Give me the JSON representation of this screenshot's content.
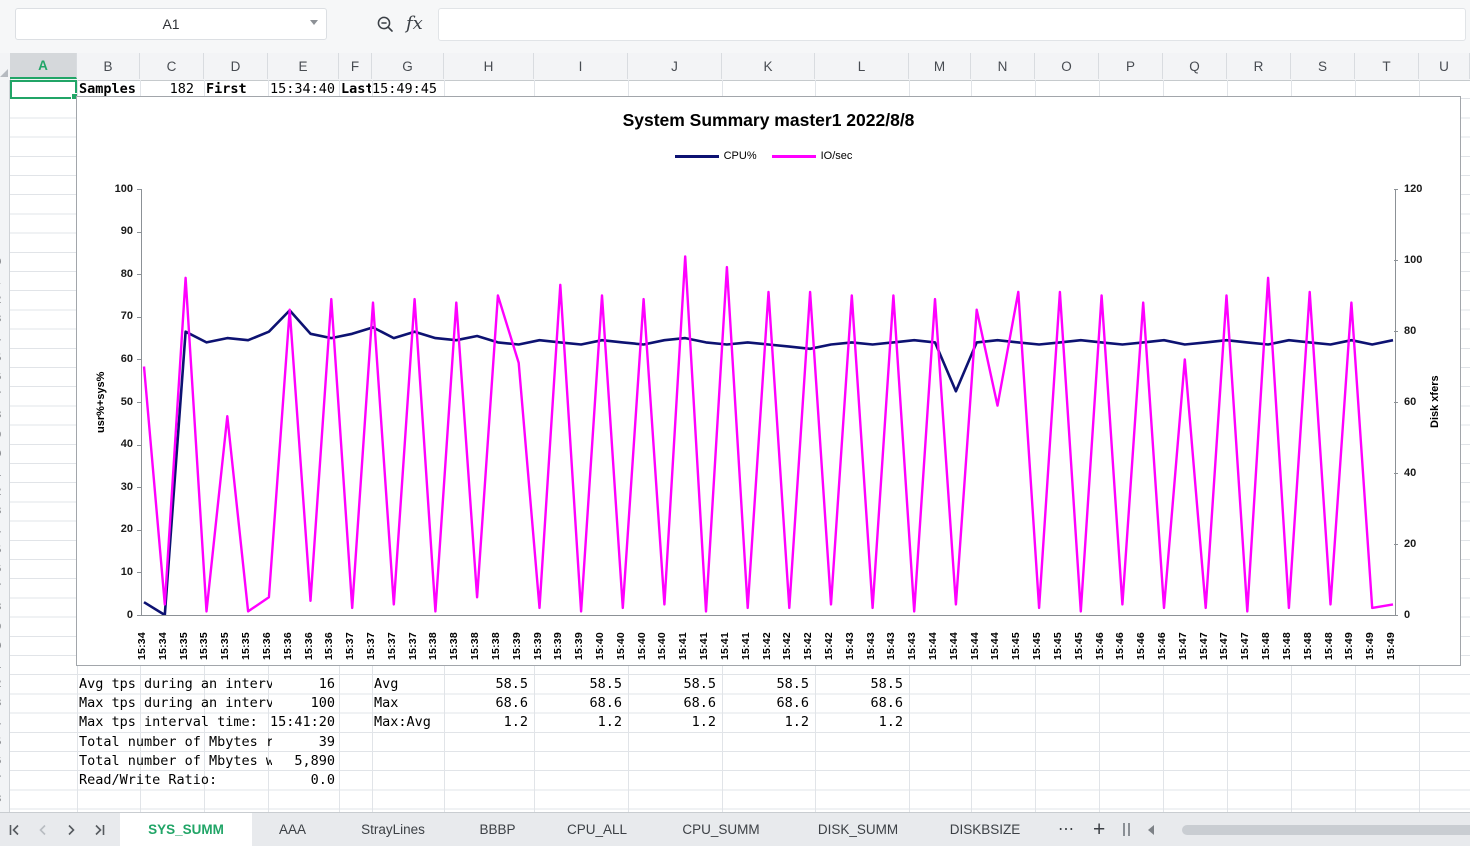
{
  "toolbar": {
    "name_box": "A1",
    "fx_label": "fx",
    "formula_value": ""
  },
  "columns": [
    "A",
    "B",
    "C",
    "D",
    "E",
    "F",
    "G",
    "H",
    "I",
    "J",
    "K",
    "L",
    "M",
    "N",
    "O",
    "P",
    "Q",
    "R",
    "S",
    "T",
    "U"
  ],
  "sheet": {
    "row1": {
      "b": "Samples",
      "c": "182",
      "d": "First",
      "e": "15:34:40",
      "f": "Last",
      "g": "15:49:45"
    },
    "stats": [
      {
        "label": "Avg tps during an interv",
        "value": "16"
      },
      {
        "label": "Max tps during an interv",
        "value": "100"
      },
      {
        "label": "Max tps interval time:",
        "value": "15:41:20"
      },
      {
        "label": "Total number of Mbytes r",
        "value": "39"
      },
      {
        "label": "Total number of Mbytes w",
        "value": "5,890"
      },
      {
        "label": "Read/Write Ratio:",
        "value": "0.0"
      }
    ],
    "summary_rows": [
      {
        "label": "Avg",
        "values": [
          "58.5",
          "58.5",
          "58.5",
          "58.5",
          "58.5"
        ]
      },
      {
        "label": "Max",
        "values": [
          "68.6",
          "68.6",
          "68.6",
          "68.6",
          "68.6"
        ]
      },
      {
        "label": "Max:Avg",
        "values": [
          "1.2",
          "1.2",
          "1.2",
          "1.2",
          "1.2"
        ]
      }
    ]
  },
  "chart_data": {
    "type": "line",
    "title": "System Summary master1  2022/8/8",
    "legend_position": "top",
    "ylabel_left": "usr%+sys%",
    "ylabel_right": "Disk xfers",
    "ylim_left": [
      0,
      100
    ],
    "ylim_right": [
      0,
      120
    ],
    "yticks_left": [
      100,
      90,
      80,
      70,
      60,
      50,
      40,
      30,
      20,
      10,
      0
    ],
    "yticks_right": [
      120,
      100,
      80,
      60,
      40,
      20,
      0
    ],
    "grid": false,
    "x": [
      "15:34",
      "15:34",
      "15:35",
      "15:35",
      "15:35",
      "15:35",
      "15:36",
      "15:36",
      "15:36",
      "15:36",
      "15:37",
      "15:37",
      "15:37",
      "15:37",
      "15:38",
      "15:38",
      "15:38",
      "15:38",
      "15:39",
      "15:39",
      "15:39",
      "15:39",
      "15:40",
      "15:40",
      "15:40",
      "15:40",
      "15:41",
      "15:41",
      "15:41",
      "15:41",
      "15:42",
      "15:42",
      "15:42",
      "15:42",
      "15:43",
      "15:43",
      "15:43",
      "15:43",
      "15:44",
      "15:44",
      "15:44",
      "15:44",
      "15:45",
      "15:45",
      "15:45",
      "15:45",
      "15:46",
      "15:46",
      "15:46",
      "15:46",
      "15:47",
      "15:47",
      "15:47",
      "15:47",
      "15:48",
      "15:48",
      "15:48",
      "15:48",
      "15:49",
      "15:49",
      "15:49"
    ],
    "series": [
      {
        "name": "CPU%",
        "axis": "left",
        "color": "#0d1272",
        "values": [
          3,
          0,
          66.5,
          64,
          65,
          64.5,
          66.5,
          71.5,
          66,
          65,
          66,
          67.5,
          65,
          66.5,
          65,
          64.5,
          65.5,
          64,
          63.5,
          64.5,
          64,
          63.5,
          64.5,
          64,
          63.5,
          64.5,
          65,
          64,
          63.5,
          64,
          63.5,
          63,
          62.5,
          63.5,
          64,
          63.5,
          64,
          64.5,
          64,
          52.5,
          64,
          64.5,
          64,
          63.5,
          64,
          64.5,
          64,
          63.5,
          64,
          64.5,
          63.5,
          64,
          64.5,
          64,
          63.5,
          64.5,
          64,
          63.5,
          64.5,
          63.5,
          64.5
        ]
      },
      {
        "name": "IO/sec",
        "axis": "right",
        "color": "#ff00ff",
        "values": [
          70,
          3,
          95,
          1,
          56,
          1,
          5,
          86,
          4,
          89,
          2,
          88,
          3,
          89,
          1,
          88,
          5,
          90,
          71,
          2,
          93,
          1,
          90,
          2,
          89,
          3,
          101,
          1,
          98,
          2,
          91,
          2,
          91,
          3,
          90,
          2,
          90,
          1,
          89,
          3,
          86,
          59,
          91,
          2,
          91,
          1,
          90,
          3,
          88,
          2,
          72,
          2,
          90,
          1,
          95,
          2,
          91,
          3,
          88,
          2,
          3
        ]
      }
    ]
  },
  "tabbar": {
    "tabs": [
      "SYS_SUMM",
      "AAA",
      "StrayLines",
      "BBBP",
      "CPU_ALL",
      "CPU_SUMM",
      "DISK_SUMM",
      "DISKBSIZE"
    ],
    "active": "SYS_SUMM",
    "more_label": "⋯",
    "add_label": "+"
  }
}
